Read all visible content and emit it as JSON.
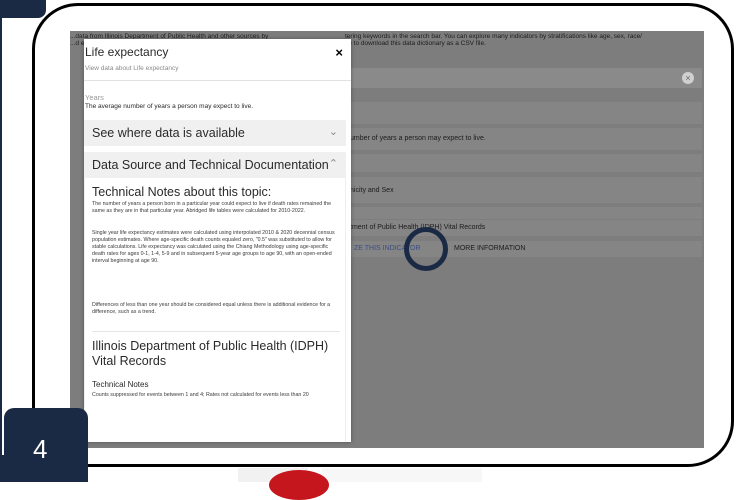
{
  "background": {
    "intro_left_lines": [
      "...data from Illinois Department of Public Health and other sources by",
      "...d e"
    ],
    "intro_right_lines": [
      "tering keywords in the search bar. You can explore many indicators by stratifications like age, sex, race/",
      "ve to download this data dictionary as a CSV file."
    ],
    "definition_row": "umber of years a person may expect to live.",
    "stratification_row": "nicity and Sex",
    "source_row": "tment of Public Health (IDPH) Vital Records",
    "visualize_link": "ZE THIS INDICATOR",
    "more_info_link": "MORE INFORMATION",
    "search_clear_icon": "×"
  },
  "modal": {
    "title": "Life expectancy",
    "subtitle": "View data about Life expectancy",
    "close_icon": "×",
    "section_label": "Years",
    "section_definition": "The average number of years a person may expect to live.",
    "accordion_availability": {
      "label": "See where data is available",
      "chevron": "⌄"
    },
    "accordion_source": {
      "label": "Data Source and Technical Documentation",
      "chevron": "⌃"
    },
    "technical_notes": {
      "title": "Technical Notes about this topic:",
      "paragraphs": [
        "The number of years a person born in a particular year could expect to live if death rates remained the same as they are in that particular year. Abridged life tables were calculated for 2010-2022.",
        "Single year life expectancy estimates were calculated using interpolated 2010 & 2020 decennial census population estimates. Where age-specific death counts equaled zero, \"0.5\" was substituted to allow for stable calculations. Life expectancy was calculated using the Chiang Methodology using age-specific death rates for ages 0-1, 1-4, 5-9 and in subsequent 5-year age groups to age 90, with an open-ended interval beginning at age 90.",
        "Differences of less than one year should be considered equal unless there is additional evidence for a difference, such as a trend."
      ]
    },
    "source": {
      "title": "Illinois Department of Public Health (IDPH) Vital Records",
      "subtitle": "Technical Notes",
      "note": "Counts suppressed for events between 1 and 4; Rates not calculated for events less than 20"
    }
  },
  "step_badge": "4"
}
